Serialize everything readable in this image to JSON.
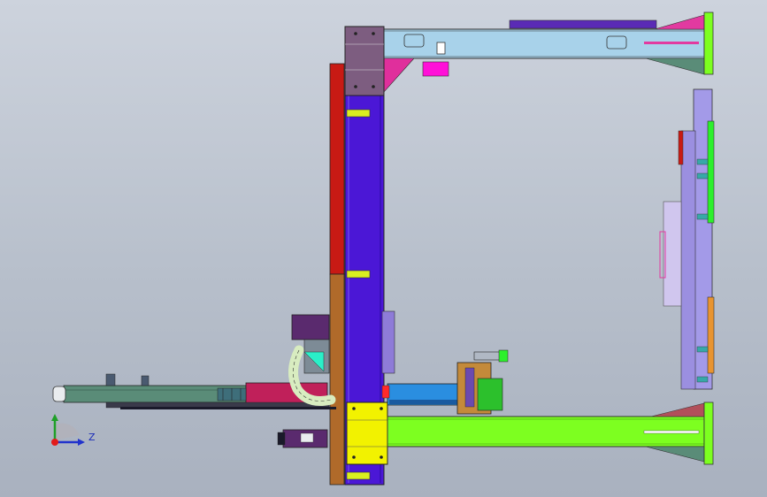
{
  "viewport": {
    "background_top": "#cdd3dd",
    "background_bottom": "#a9b1bf"
  },
  "colors": {
    "column_blue": "#4b17d6",
    "beam_light_blue": "#a8d2ea",
    "plate_mauve": "#7d5d80",
    "red_rail": "#c81a14",
    "brown_rail": "#b06a2a",
    "green_beam": "#7dff20",
    "yellow_block": "#f2f200",
    "teal_arm": "#5a8c78",
    "crimson_arm": "#c0205a",
    "magenta_block": "#ff10d8",
    "pink_gusset": "#e02f9c",
    "violet_frame": "#a39ae8",
    "orange_frame": "#e89430",
    "bright_green": "#2cf02c",
    "gripper_blue": "#2a8ee0"
  },
  "triad": {
    "z_label": "Z",
    "icon": "coordinate-axis-triad-icon"
  }
}
